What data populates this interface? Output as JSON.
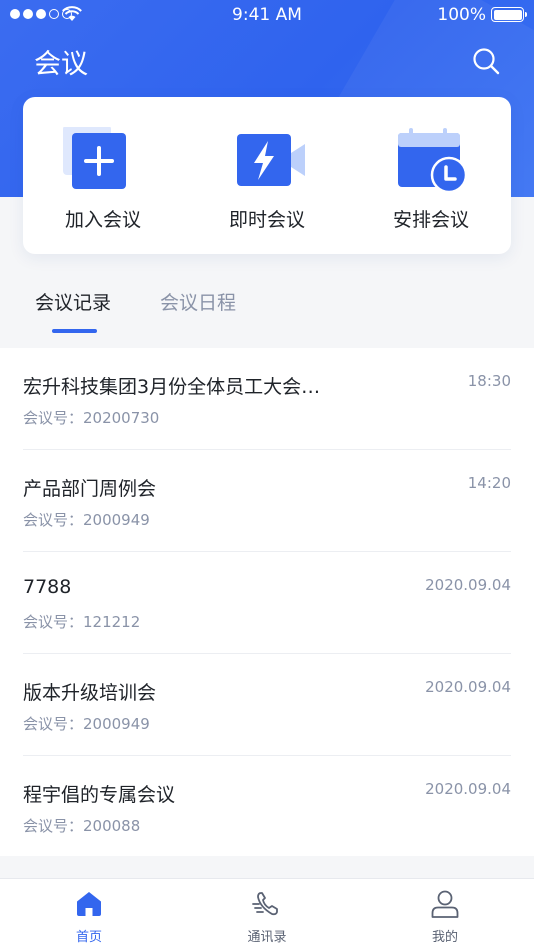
{
  "status_bar": {
    "time": "9:41 AM",
    "battery": "100%"
  },
  "header": {
    "title": "会议"
  },
  "quick_actions": [
    {
      "label": "加入会议",
      "icon": "plus-icon"
    },
    {
      "label": "即时会议",
      "icon": "video-flash-icon"
    },
    {
      "label": "安排会议",
      "icon": "calendar-clock-icon"
    }
  ],
  "tabs": [
    {
      "label": "会议记录",
      "active": true
    },
    {
      "label": "会议日程",
      "active": false
    }
  ],
  "meetings": [
    {
      "title": "宏升科技集团3月份全体员工大会…",
      "number_label": "会议号：20200730",
      "time": "18:30"
    },
    {
      "title": "产品部门周例会",
      "number_label": "会议号：2000949",
      "time": "14:20"
    },
    {
      "title": "7788",
      "number_label": "会议号：121212",
      "time": "2020.09.04"
    },
    {
      "title": "版本升级培训会",
      "number_label": "会议号：2000949",
      "time": "2020.09.04"
    },
    {
      "title": "程宇倡的专属会议",
      "number_label": "会议号：200088",
      "time": "2020.09.04"
    }
  ],
  "tabbar": [
    {
      "label": "首页",
      "icon": "home-icon",
      "active": true
    },
    {
      "label": "通讯录",
      "icon": "phone-icon",
      "active": false
    },
    {
      "label": "我的",
      "icon": "user-icon",
      "active": false
    }
  ],
  "colors": {
    "primary": "#3366ee",
    "text": "#1f2329",
    "muted": "#8a93a8"
  }
}
